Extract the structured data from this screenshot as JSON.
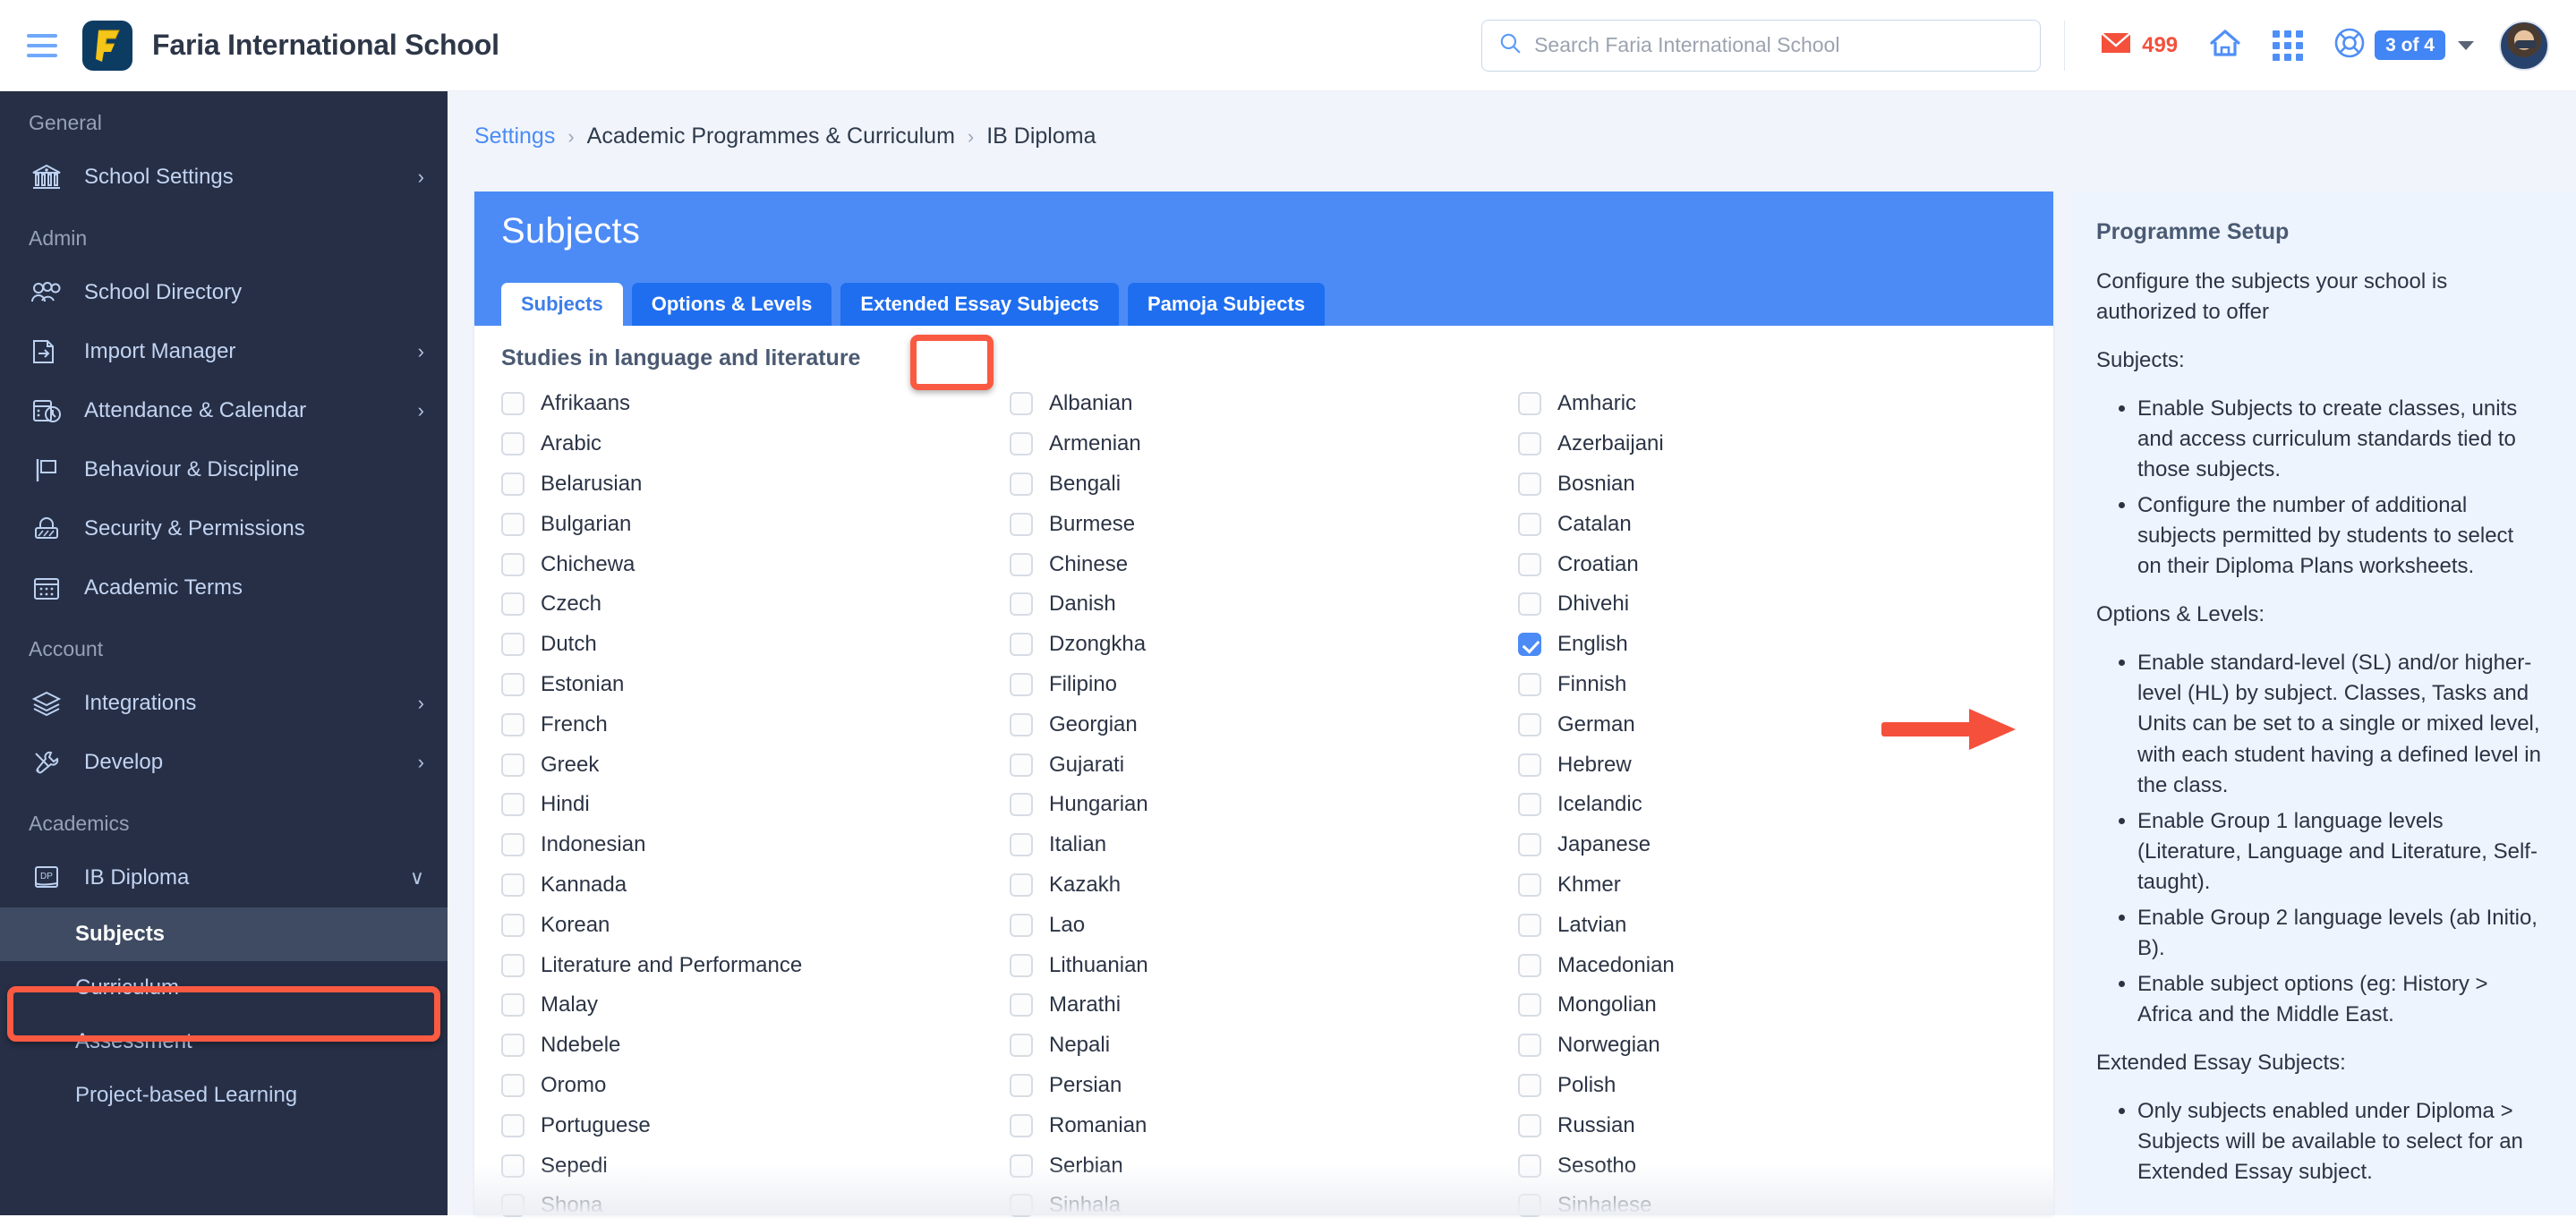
{
  "header": {
    "brand": "Faria International School",
    "search_placeholder": "Search Faria International School",
    "mail_count": "499",
    "account_badge": "3 of 4"
  },
  "sidebar": {
    "sections": [
      {
        "label": "General",
        "items": [
          {
            "label": "School Settings",
            "icon": "bank-icon",
            "chevron": "›"
          }
        ]
      },
      {
        "label": "Admin",
        "items": [
          {
            "label": "School Directory",
            "icon": "people-icon",
            "chevron": ""
          },
          {
            "label": "Import Manager",
            "icon": "import-icon",
            "chevron": "›"
          },
          {
            "label": "Attendance & Calendar",
            "icon": "calendar-clock-icon",
            "chevron": "›"
          },
          {
            "label": "Behaviour & Discipline",
            "icon": "flag-icon",
            "chevron": ""
          },
          {
            "label": "Security & Permissions",
            "icon": "lock-icon",
            "chevron": ""
          },
          {
            "label": "Academic Terms",
            "icon": "calendar-icon",
            "chevron": ""
          }
        ]
      },
      {
        "label": "Account",
        "items": [
          {
            "label": "Integrations",
            "icon": "layers-icon",
            "chevron": "›"
          },
          {
            "label": "Develop",
            "icon": "tools-icon",
            "chevron": "›"
          }
        ]
      },
      {
        "label": "Academics",
        "items": [
          {
            "label": "IB Diploma",
            "icon": "dp-book-icon",
            "chevron": "∨"
          }
        ]
      }
    ],
    "sub_items": [
      {
        "label": "Subjects",
        "active": true
      },
      {
        "label": "Curriculum",
        "active": false
      },
      {
        "label": "Assessment",
        "active": false
      },
      {
        "label": "Project-based Learning",
        "active": false
      }
    ]
  },
  "breadcrumb": [
    {
      "text": "Settings",
      "link": true
    },
    {
      "text": "Academic Programmes & Curriculum",
      "link": false
    },
    {
      "text": "IB Diploma",
      "link": false
    }
  ],
  "panel": {
    "title": "Subjects",
    "tabs": [
      {
        "label": "Subjects",
        "active": true
      },
      {
        "label": "Options & Levels",
        "active": false
      },
      {
        "label": "Extended Essay Subjects",
        "active": false
      },
      {
        "label": "Pamoja Subjects",
        "active": false
      }
    ],
    "group_title": "Studies in language and literature",
    "columns": [
      [
        {
          "label": "Afrikaans",
          "checked": false
        },
        {
          "label": "Arabic",
          "checked": false
        },
        {
          "label": "Belarusian",
          "checked": false
        },
        {
          "label": "Bulgarian",
          "checked": false
        },
        {
          "label": "Chichewa",
          "checked": false
        },
        {
          "label": "Czech",
          "checked": false
        },
        {
          "label": "Dutch",
          "checked": false
        },
        {
          "label": "Estonian",
          "checked": false
        },
        {
          "label": "French",
          "checked": false
        },
        {
          "label": "Greek",
          "checked": false
        },
        {
          "label": "Hindi",
          "checked": false
        },
        {
          "label": "Indonesian",
          "checked": false
        },
        {
          "label": "Kannada",
          "checked": false
        },
        {
          "label": "Korean",
          "checked": false
        },
        {
          "label": "Literature and Performance",
          "checked": false
        },
        {
          "label": "Malay",
          "checked": false
        },
        {
          "label": "Ndebele",
          "checked": false
        },
        {
          "label": "Oromo",
          "checked": false
        },
        {
          "label": "Portuguese",
          "checked": false
        },
        {
          "label": "Sepedi",
          "checked": false
        },
        {
          "label": "Shona",
          "checked": false
        }
      ],
      [
        {
          "label": "Albanian",
          "checked": false
        },
        {
          "label": "Armenian",
          "checked": false
        },
        {
          "label": "Bengali",
          "checked": false
        },
        {
          "label": "Burmese",
          "checked": false
        },
        {
          "label": "Chinese",
          "checked": false
        },
        {
          "label": "Danish",
          "checked": false
        },
        {
          "label": "Dzongkha",
          "checked": false
        },
        {
          "label": "Filipino",
          "checked": false
        },
        {
          "label": "Georgian",
          "checked": false
        },
        {
          "label": "Gujarati",
          "checked": false
        },
        {
          "label": "Hungarian",
          "checked": false
        },
        {
          "label": "Italian",
          "checked": false
        },
        {
          "label": "Kazakh",
          "checked": false
        },
        {
          "label": "Lao",
          "checked": false
        },
        {
          "label": "Lithuanian",
          "checked": false
        },
        {
          "label": "Marathi",
          "checked": false
        },
        {
          "label": "Nepali",
          "checked": false
        },
        {
          "label": "Persian",
          "checked": false
        },
        {
          "label": "Romanian",
          "checked": false
        },
        {
          "label": "Serbian",
          "checked": false
        },
        {
          "label": "Sinhala",
          "checked": false
        }
      ],
      [
        {
          "label": "Amharic",
          "checked": false
        },
        {
          "label": "Azerbaijani",
          "checked": false
        },
        {
          "label": "Bosnian",
          "checked": false
        },
        {
          "label": "Catalan",
          "checked": false
        },
        {
          "label": "Croatian",
          "checked": false
        },
        {
          "label": "Dhivehi",
          "checked": false
        },
        {
          "label": "English",
          "checked": true
        },
        {
          "label": "Finnish",
          "checked": false
        },
        {
          "label": "German",
          "checked": false
        },
        {
          "label": "Hebrew",
          "checked": false
        },
        {
          "label": "Icelandic",
          "checked": false
        },
        {
          "label": "Japanese",
          "checked": false
        },
        {
          "label": "Khmer",
          "checked": false
        },
        {
          "label": "Latvian",
          "checked": false
        },
        {
          "label": "Macedonian",
          "checked": false
        },
        {
          "label": "Mongolian",
          "checked": false
        },
        {
          "label": "Norwegian",
          "checked": false
        },
        {
          "label": "Polish",
          "checked": false
        },
        {
          "label": "Russian",
          "checked": false
        },
        {
          "label": "Sesotho",
          "checked": false
        },
        {
          "label": "Sinhalese",
          "checked": false
        }
      ]
    ]
  },
  "info_panel": {
    "title": "Programme Setup",
    "intro": "Configure the subjects your school is authorized to offer",
    "sections": [
      {
        "heading": "Subjects:",
        "bullets": [
          "Enable Subjects to create classes, units and access curriculum standards tied to those subjects.",
          "Configure the number of additional subjects permitted by students to select on their Diploma Plans worksheets."
        ]
      },
      {
        "heading": "Options & Levels:",
        "bullets": [
          "Enable standard-level (SL) and/or higher-level (HL) by subject. Classes, Tasks and Units can be set to a single or mixed level, with each student having a defined level in the class.",
          "Enable Group 1 language levels (Literature, Language and Literature, Self-taught).",
          "Enable Group 2 language levels (ab Initio, B).",
          "Enable subject options (eg: History > Africa and the Middle East."
        ]
      },
      {
        "heading": "Extended Essay Subjects:",
        "bullets": [
          "Only subjects enabled under Diploma > Subjects will be available to select for an Extended Essay subject."
        ]
      }
    ]
  },
  "annotations": {
    "highlight_color": "#fa5a42",
    "arrow_target": "English"
  }
}
